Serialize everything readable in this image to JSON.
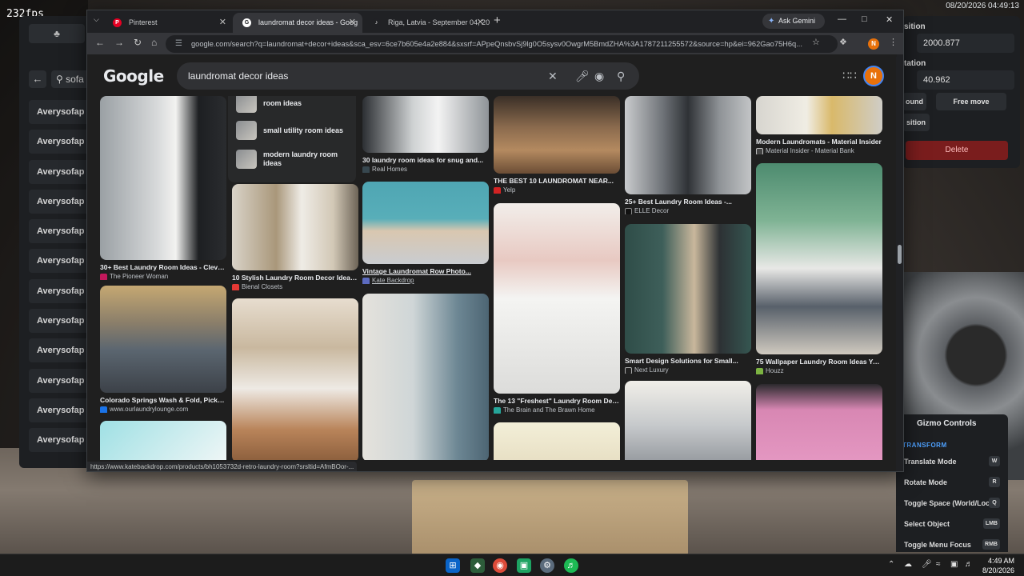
{
  "hud": {
    "fps": "232fps",
    "datetime": "08/20/2026 04:49:13"
  },
  "game_left_panel": {
    "search_text": "sofa",
    "items": [
      "Averysofap",
      "Averysofap",
      "Averysofap",
      "Averysofap",
      "Averysofap",
      "Averysofap",
      "Averysofap",
      "Averysofap",
      "Averysofap",
      "Averysofap",
      "Averysofap",
      "Averysofap"
    ]
  },
  "game_right_panel": {
    "label_position": "sition",
    "label_rotation": "tation",
    "field_1": "2000.877",
    "field_2": "40.962",
    "btn_ground": "ound",
    "btn_free_move": "Free move",
    "btn_position": "sition",
    "btn_delete": "Delete"
  },
  "gizmo": {
    "title": "Gizmo Controls",
    "section": "TRANSFORM",
    "rows": [
      {
        "label": "Translate Mode",
        "key": "W"
      },
      {
        "label": "Rotate Mode",
        "key": "R"
      },
      {
        "label": "Toggle Space (World/Local)",
        "key": "Q"
      },
      {
        "label": "Select Object",
        "key": "LMB"
      },
      {
        "label": "Toggle Menu Focus",
        "key": "RMB"
      }
    ]
  },
  "browser": {
    "tabs": [
      {
        "label": "Pinterest"
      },
      {
        "label": "laundromat decor ideas - Goog"
      },
      {
        "label": "Riga, Latvia - September 04, 20"
      }
    ],
    "gemini_label": "Ask Gemini",
    "url": "google.com/search?q=laundromat+decor+ideas&sca_esv=6ce7b605e4a2e884&sxsrf=APpeQnsbvSj9lg0O5sysv0OwgrM5BmdZHA%3A1787211255572&source=hp&ei=962Gao75H6q...",
    "profile_initial": "N",
    "status_url": "https://www.katebackdrop.com/products/bh1053732d-retro-laundry-room?srsltid=AfmBOor-..."
  },
  "google": {
    "logo": "Google",
    "query": "laundromat decor ideas",
    "related": [
      "room ideas",
      "small utility room ideas",
      "modern laundry room ideas"
    ]
  },
  "pins": [
    {
      "title": "30+ Best Laundry Room Ideas - Clever...",
      "source": "The Pioneer Woman"
    },
    {
      "title": "Colorado Springs Wash & Fold, Pickup ...",
      "source": "www.ourlaundrylounge.com"
    },
    {
      "title": "10 Stylish Laundry Room Decor Ideas t...",
      "source": "Bienal Closets"
    },
    {
      "title": "30 laundry room ideas for snug and...",
      "source": "Real Homes"
    },
    {
      "title": "Vintage Laundromat Row Photo...",
      "source": "Kate Backdrop"
    },
    {
      "title": "THE BEST 10 LAUNDROMAT NEAR...",
      "source": "Yelp"
    },
    {
      "title": "The 13 \"Freshest\" Laundry Room Deco...",
      "source": "The Brain and The Brawn Home"
    },
    {
      "title": "25+ Best Laundry Room Ideas -...",
      "source": "ELLE Decor"
    },
    {
      "title": "Smart Design Solutions for Small...",
      "source": "Next Luxury"
    },
    {
      "title": "Modern Laundromats - Material Insider",
      "source": "Material Insider - Material Bank"
    },
    {
      "title": "75 Wallpaper Laundry Room Ideas You'...",
      "source": "Houzz"
    }
  ],
  "taskbar": {
    "time": "4:49 AM",
    "date": "8/20/2026"
  },
  "colors": {
    "accent": "#8ab4f8",
    "profile": "#e8710a",
    "pinterest": "#e60023",
    "delete": "#7a1d1d"
  }
}
